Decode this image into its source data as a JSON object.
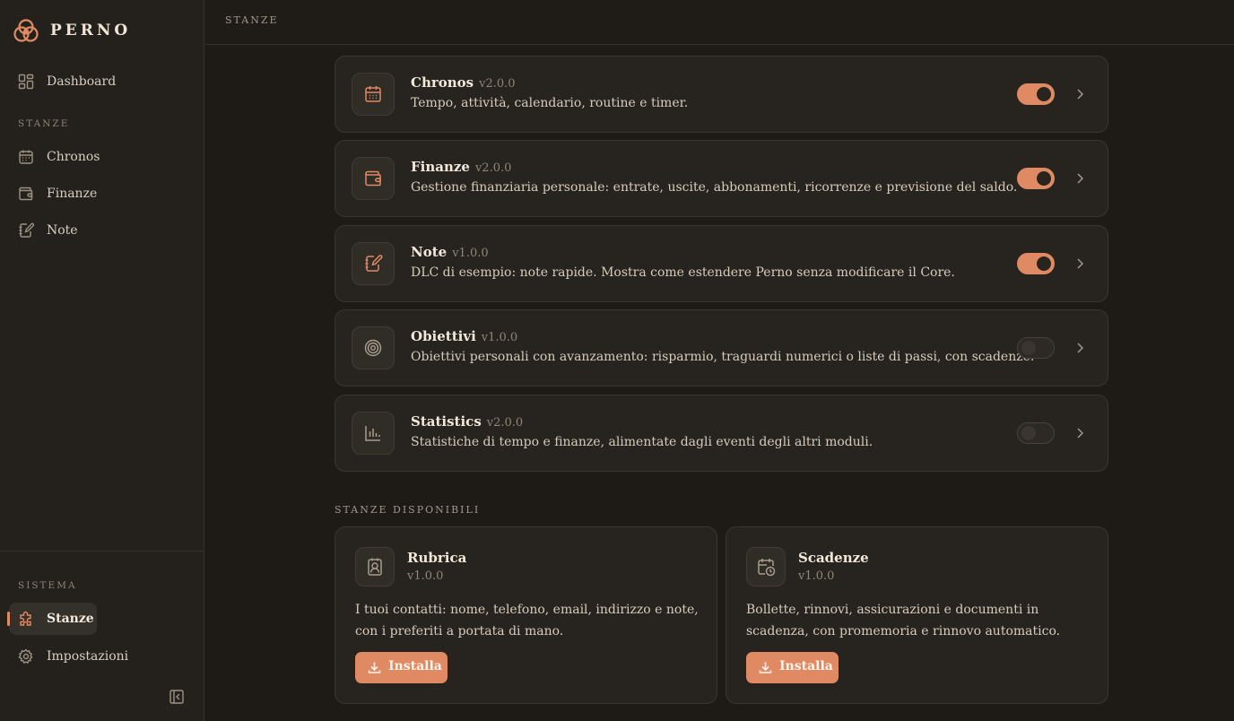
{
  "brand": {
    "name": "PERNO"
  },
  "sidebar": {
    "dashboard": {
      "label": "Dashboard",
      "icon": "dashboard-grid-icon"
    },
    "section_stanze": "STANZE",
    "rooms": [
      {
        "label": "Chronos",
        "icon": "calendar-icon"
      },
      {
        "label": "Finanze",
        "icon": "wallet-icon"
      },
      {
        "label": "Note",
        "icon": "notebook-pen-icon"
      }
    ],
    "section_sistema": "SISTEMA",
    "system": [
      {
        "label": "Stanze",
        "icon": "puzzle-icon",
        "active": true
      },
      {
        "label": "Impostazioni",
        "icon": "gear-icon"
      }
    ]
  },
  "header": {
    "title": "STANZE"
  },
  "installed_modules": [
    {
      "name": "Chronos",
      "version": "v2.0.0",
      "description": "Tempo, attività, calendario, routine e timer.",
      "enabled": true,
      "icon": "calendar-icon"
    },
    {
      "name": "Finanze",
      "version": "v2.0.0",
      "description": "Gestione finanziaria personale: entrate, uscite, abbonamenti, ricorrenze e previsione del saldo.",
      "enabled": true,
      "icon": "wallet-icon"
    },
    {
      "name": "Note",
      "version": "v1.0.0",
      "description": "DLC di esempio: note rapide. Mostra come estendere Perno senza modificare il Core.",
      "enabled": true,
      "icon": "notebook-pen-icon"
    },
    {
      "name": "Obiettivi",
      "version": "v1.0.0",
      "description": "Obiettivi personali con avanzamento: risparmio, traguardi numerici o liste di passi, con scadenze.",
      "enabled": false,
      "icon": "target-icon"
    },
    {
      "name": "Statistics",
      "version": "v2.0.0",
      "description": "Statistiche di tempo e finanze, alimentate dagli eventi degli altri moduli.",
      "enabled": false,
      "icon": "bar-chart-icon"
    }
  ],
  "available": {
    "title": "STANZE DISPONIBILI",
    "items": [
      {
        "name": "Rubrica",
        "version": "v1.0.0",
        "description": "I tuoi contatti: nome, telefono, email, indirizzo e note, con i preferiti a portata di mano.",
        "button": "Installa",
        "icon": "contact-book-icon"
      },
      {
        "name": "Scadenze",
        "version": "v1.0.0",
        "description": "Bollette, rinnovi, assicurazioni e documenti in scadenza, con promemoria e rinnovo automatico.",
        "button": "Installa",
        "icon": "calendar-clock-icon"
      }
    ]
  },
  "colors": {
    "accent": "#e08a63",
    "background": "#1e1b17",
    "sidebar": "#24211d",
    "card": "#27241f"
  }
}
